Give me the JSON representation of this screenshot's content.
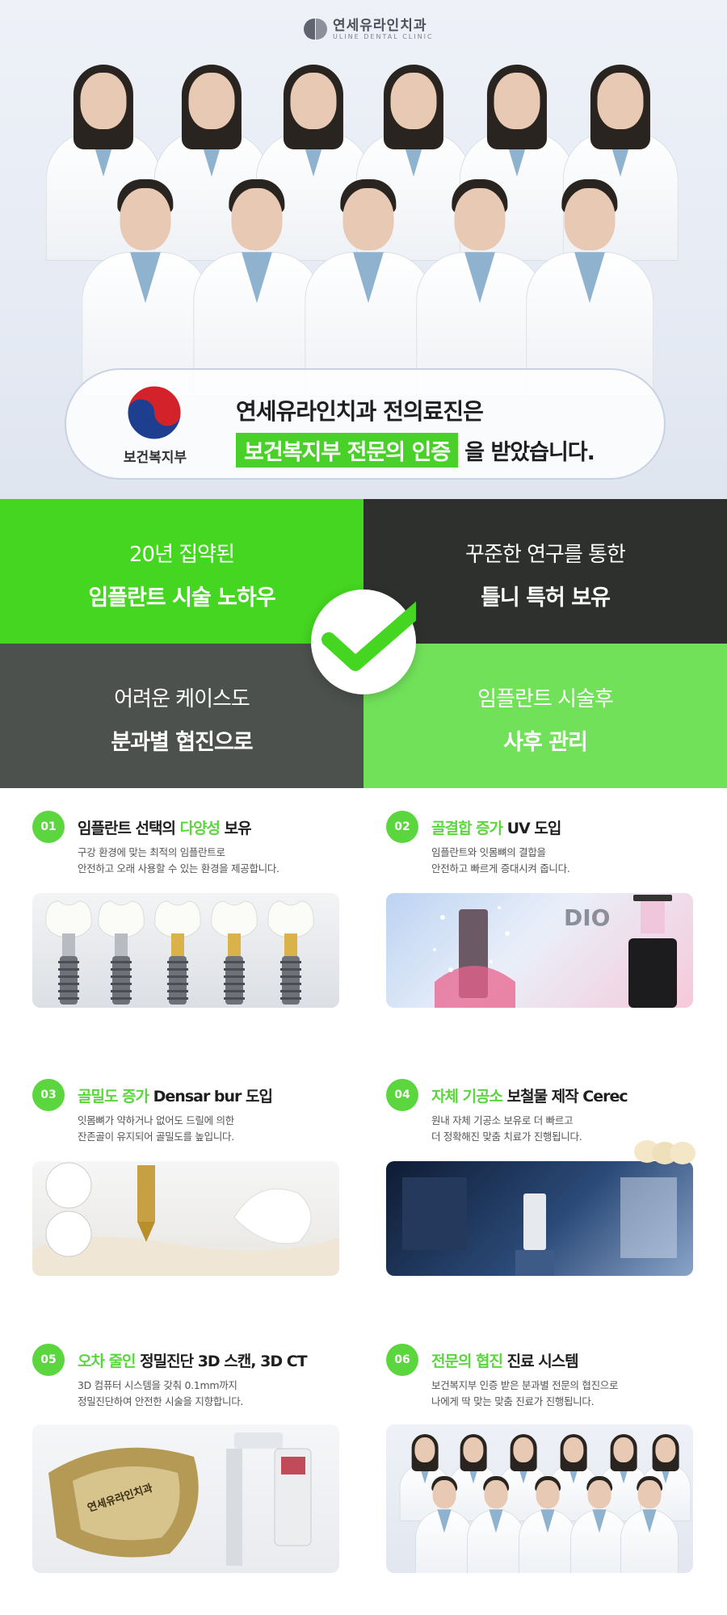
{
  "brand": {
    "name_kr": "연세유라인치과",
    "name_en": "ULINE DENTAL CLINIC"
  },
  "certification": {
    "ministry_label": "보건복지부",
    "line1": "연세유라인치과 전의료진은",
    "highlight": "보건복지부 전문의 인증",
    "tail": "을 받았습니다."
  },
  "features": [
    {
      "line1": "20년 집약된",
      "line2": "임플란트 시술 노하우"
    },
    {
      "line1": "꾸준한 연구를 통한",
      "line2": "틀니 특허 보유"
    },
    {
      "line1": "어려운 케이스도",
      "line2": "분과별 협진으로"
    },
    {
      "line1": "임플란트 시술후",
      "line2": "사후 관리"
    }
  ],
  "items": [
    {
      "num": "01",
      "title_pre": "임플란트 선택의 ",
      "title_hl": "다양성",
      "title_post": " 보유",
      "desc1": "구강 환경에 맞는 최적의 임플란트로",
      "desc2": "안전하고 오래 사용할 수 있는 환경을 제공합니다."
    },
    {
      "num": "02",
      "title_pre": "",
      "title_hl": "골결합 증가",
      "title_post": " UV 도입",
      "desc1": "임플란트와 잇몸뼈의 결합을",
      "desc2": "안전하고 빠르게 증대시켜 줍니다.",
      "brand_label": "DIO"
    },
    {
      "num": "03",
      "title_pre": "",
      "title_hl": "골밀도 증가",
      "title_post": " Densar bur 도입",
      "desc1": "잇몸뼈가 약하거나 없어도 드릴에 의한",
      "desc2": "잔존골이 유지되어 골밀도를 높입니다."
    },
    {
      "num": "04",
      "title_pre": "",
      "title_hl": "자체 기공소",
      "title_post": " 보철물 제작 Cerec",
      "desc1": "원내 자체 기공소 보유로 더 빠르고",
      "desc2": "더 정확해진 맞춤 치료가 진행됩니다."
    },
    {
      "num": "05",
      "title_pre": "",
      "title_hl": "오차 줄인",
      "title_post": " 정밀진단 3D 스캔, 3D CT",
      "desc1": "3D 컴퓨터 시스템을 갖춰 0.1mm까지",
      "desc2": "정밀진단하여 안전한 시술을 지향합니다.",
      "model_label": "연세유라인치과"
    },
    {
      "num": "06",
      "title_pre": "",
      "title_hl": "전문의 협진",
      "title_post": " 진료 시스템",
      "desc1": "보건복지부 인증 받은 분과별 전문의 협진으로",
      "desc2": "나에게 딱 맞는 맞춤 진료가 진행됩니다."
    }
  ],
  "colors": {
    "accent_green": "#44d620",
    "light_green": "#72e15a",
    "dark": "#2e302e",
    "gray": "#4d514d"
  }
}
